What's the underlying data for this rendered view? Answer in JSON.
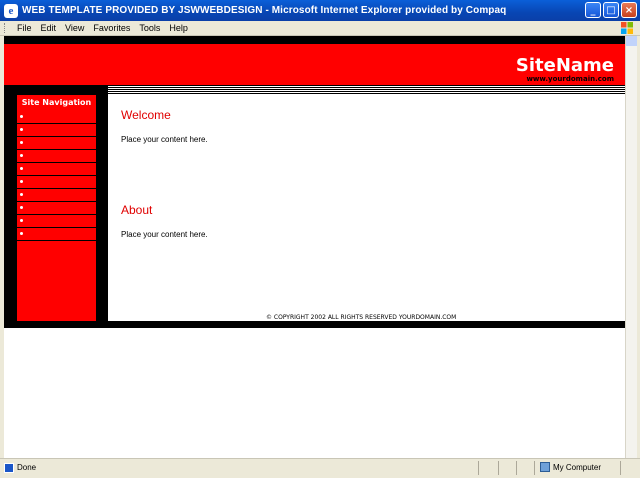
{
  "window": {
    "title": "WEB TEMPLATE PROVIDED BY JSWWEBDESIGN - Microsoft Internet Explorer provided by Compaq",
    "icon_glyph": "e",
    "minimize_glyph": "_",
    "maximize_glyph": "□",
    "close_glyph": "×"
  },
  "menu": {
    "items": [
      "File",
      "Edit",
      "View",
      "Favorites",
      "Tools",
      "Help"
    ]
  },
  "page": {
    "site_name": "SiteName",
    "site_domain": "www.yourdomain.com",
    "sidebar_title": "Site Navigation",
    "nav_item_count_visible": 10,
    "sections": [
      {
        "heading": "Welcome",
        "body": "Place your content here."
      },
      {
        "heading": "About",
        "body": "Place your content here."
      }
    ],
    "copyright": "© COPYRIGHT 2002 ALL RIGHTS RESERVED YOURDOMAIN.COM"
  },
  "status": {
    "text": "Done",
    "zone": "My Computer"
  },
  "colors": {
    "brand_red": "#ff0000",
    "heading_red": "#e00000",
    "black": "#000000"
  }
}
